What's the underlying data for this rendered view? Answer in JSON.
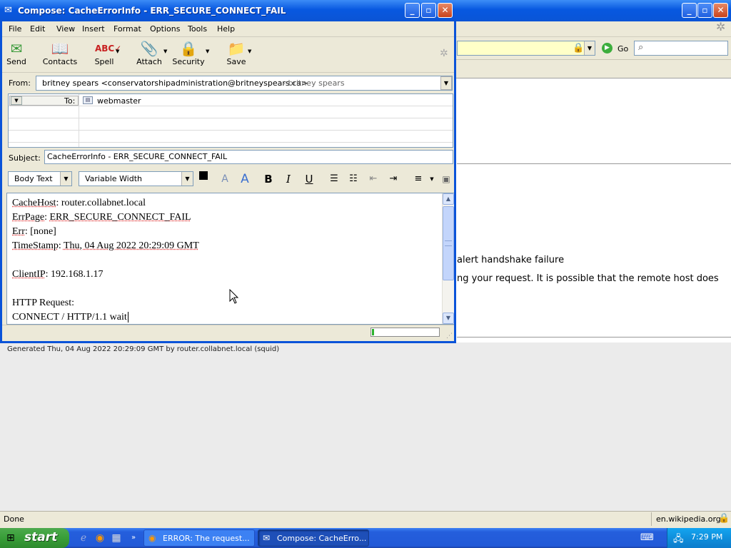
{
  "background_window": {
    "url_bar": {
      "go_label": "Go"
    },
    "content_lines": [
      "alert handshake failure",
      "ng your request. It is possible that the remote host does"
    ],
    "generated_text": "Generated Thu, 04 Aug 2022 20:29:09 GMT by router.collabnet.local (squid)",
    "status": {
      "left": "Done",
      "host": "en.wikipedia.org"
    }
  },
  "compose": {
    "title": "Compose: CacheErrorInfo - ERR_SECURE_CONNECT_FAIL",
    "menu": [
      "File",
      "Edit",
      "View",
      "Insert",
      "Format",
      "Options",
      "Tools",
      "Help"
    ],
    "toolbar": [
      {
        "label": "Send",
        "icon": "send-icon"
      },
      {
        "label": "Contacts",
        "icon": "contacts-icon"
      },
      {
        "label": "Spell",
        "icon": "spell-icon"
      },
      {
        "label": "Attach",
        "icon": "attach-icon"
      },
      {
        "label": "Security",
        "icon": "security-icon"
      },
      {
        "label": "Save",
        "icon": "save-icon"
      }
    ],
    "from_label": "From:",
    "from_value": "britney spears <conservatorshipadministration@britneyspears.ca>",
    "from_name": "- britney spears",
    "to_label": "To:",
    "to_value": "webmaster",
    "subject_label": "Subject:",
    "subject_value": "CacheErrorInfo - ERR_SECURE_CONNECT_FAIL",
    "format": {
      "paragraph_style": "Body Text",
      "font": "Variable Width",
      "bold": "B",
      "italic": "I",
      "underline": "U"
    },
    "body": {
      "cache_host_label": "CacheHost",
      "cache_host_value": ": router.collabnet.local",
      "err_page_label": "ErrPage",
      "err_page_value": "ERR_SECURE_CONNECT_FAIL",
      "err_label": "Err",
      "err_value": ": [none]",
      "timestamp_label": "TimeStamp",
      "timestamp_value": "Thu, 04 Aug 2022 20:29:09 GMT",
      "client_ip_label": "ClientIP",
      "client_ip_value": ": 192.168.1.17",
      "http_request": "HTTP Request:",
      "connect_line": "CONNECT / HTTP/1.1 wait"
    }
  },
  "taskbar": {
    "start_label": "start",
    "tasks": [
      {
        "label": "ERROR: The request...",
        "active": false
      },
      {
        "label": "Compose: CacheErro...",
        "active": true
      }
    ],
    "clock": "7:29 PM"
  },
  "colors": {
    "xp_blue": "#0a55d6",
    "start_green": "#389e38",
    "url_bar_yellow": "#ffffc8"
  }
}
